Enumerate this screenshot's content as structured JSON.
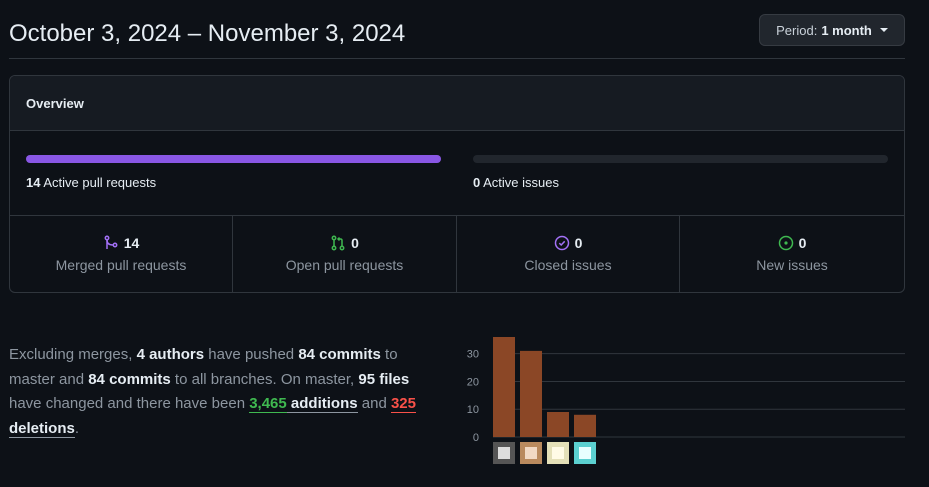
{
  "header": {
    "date_range": "October 3, 2024 – November 3, 2024",
    "period_label": "Period:",
    "period_value": "1 month"
  },
  "overview": {
    "title": "Overview",
    "pull_requests_bar": {
      "count": "14",
      "label": "Active pull requests",
      "fill_fraction": 1.0,
      "color": "#8957e5"
    },
    "issues_bar": {
      "count": "0",
      "label": "Active issues",
      "fill_fraction": 0.0
    },
    "stats": [
      {
        "icon": "merged-pr-icon",
        "value": "14",
        "label": "Merged pull requests",
        "color": "#a371f7"
      },
      {
        "icon": "open-pr-icon",
        "value": "0",
        "label": "Open pull requests",
        "color": "#3fb950"
      },
      {
        "icon": "closed-issue-icon",
        "value": "0",
        "label": "Closed issues",
        "color": "#a371f7"
      },
      {
        "icon": "new-issue-icon",
        "value": "0",
        "label": "New issues",
        "color": "#3fb950"
      }
    ]
  },
  "summary": {
    "t1": "Excluding merges, ",
    "authors": "4 authors",
    "t2": " have pushed ",
    "commits_master": "84 commits",
    "t3": " to master and ",
    "commits_all": "84 commits",
    "t4": " to all branches. On master, ",
    "files": "95 files",
    "t5": " have changed and there have been ",
    "additions_num": "3,465",
    "additions_word": " additions",
    "t6": " and ",
    "deletions_num": "325",
    "deletions_word": " deletions",
    "t7": "."
  },
  "chart_data": {
    "type": "bar",
    "categories": [
      "author 1",
      "author 2",
      "author 3",
      "author 4"
    ],
    "values": [
      36,
      31,
      9,
      8
    ],
    "ylim": [
      0,
      36
    ],
    "yticks": [
      0,
      10,
      20,
      30
    ],
    "bar_color": "#8b4726",
    "grid": true
  }
}
